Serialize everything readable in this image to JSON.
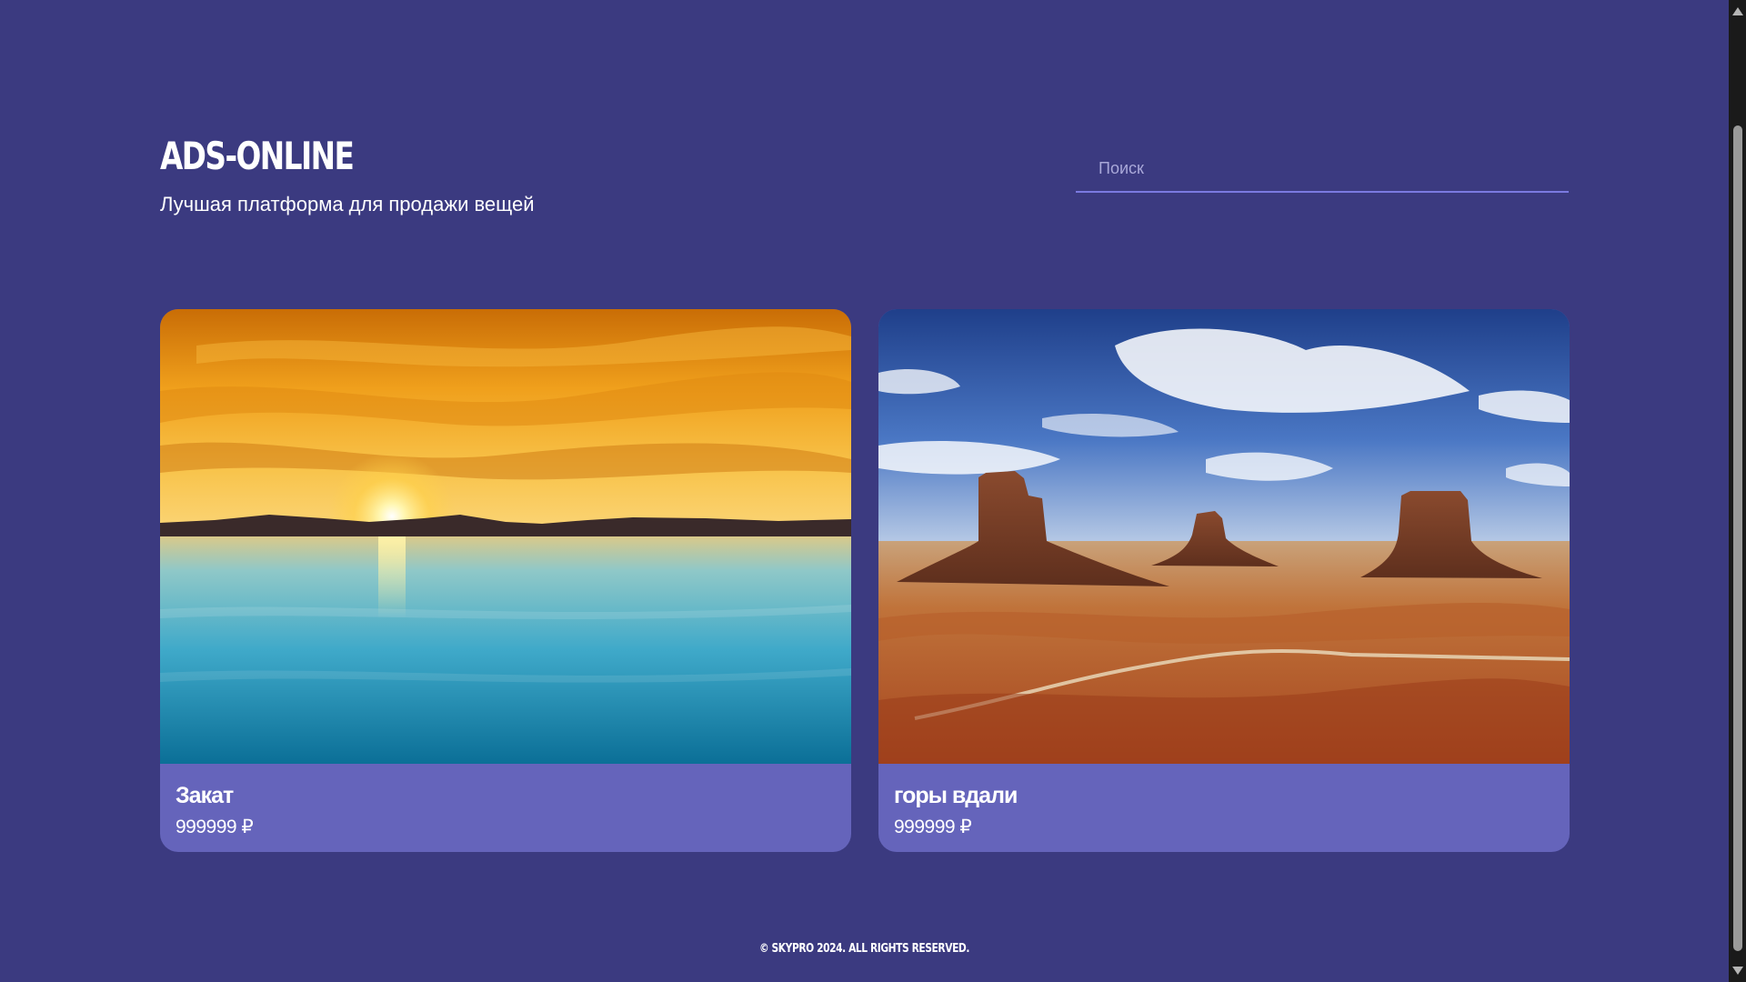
{
  "header": {
    "brand": "ADS-ONLINE",
    "subtitle": "Лучшая платформа для продажи вещей"
  },
  "search": {
    "placeholder": "Поиск",
    "value": ""
  },
  "cards": [
    {
      "title": "Закат",
      "price": "999999 ₽",
      "image": "sunset-over-water-photo"
    },
    {
      "title": "горы вдали",
      "price": "999999 ₽",
      "image": "desert-buttes-landscape-photo"
    }
  ],
  "footer": {
    "copyright": "© SKYPRO 2024. ALL RIGHTS RESERVED."
  },
  "colors": {
    "background": "#3b3a80",
    "card": "#6564bb",
    "search_underline": "#7b7ae0"
  }
}
